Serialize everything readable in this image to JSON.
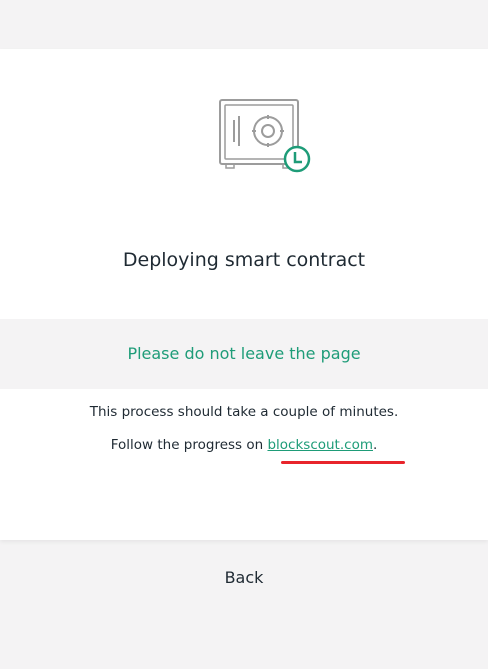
{
  "deploy": {
    "title": "Deploying smart contract",
    "warning": "Please do not leave the page",
    "info_line1": "This process should take a couple of minutes.",
    "info_line2_prefix": "Follow the progress on ",
    "link_text": "blockscout.com",
    "info_line2_suffix": ".",
    "icon": "safe-with-clock-icon",
    "loader_icon": "loading-dots-icon"
  },
  "footer": {
    "back_label": "Back"
  },
  "colors": {
    "accent": "#1e9c78",
    "annotation_underline": "#e8242b",
    "background": "#f4f3f4",
    "card": "#ffffff"
  }
}
